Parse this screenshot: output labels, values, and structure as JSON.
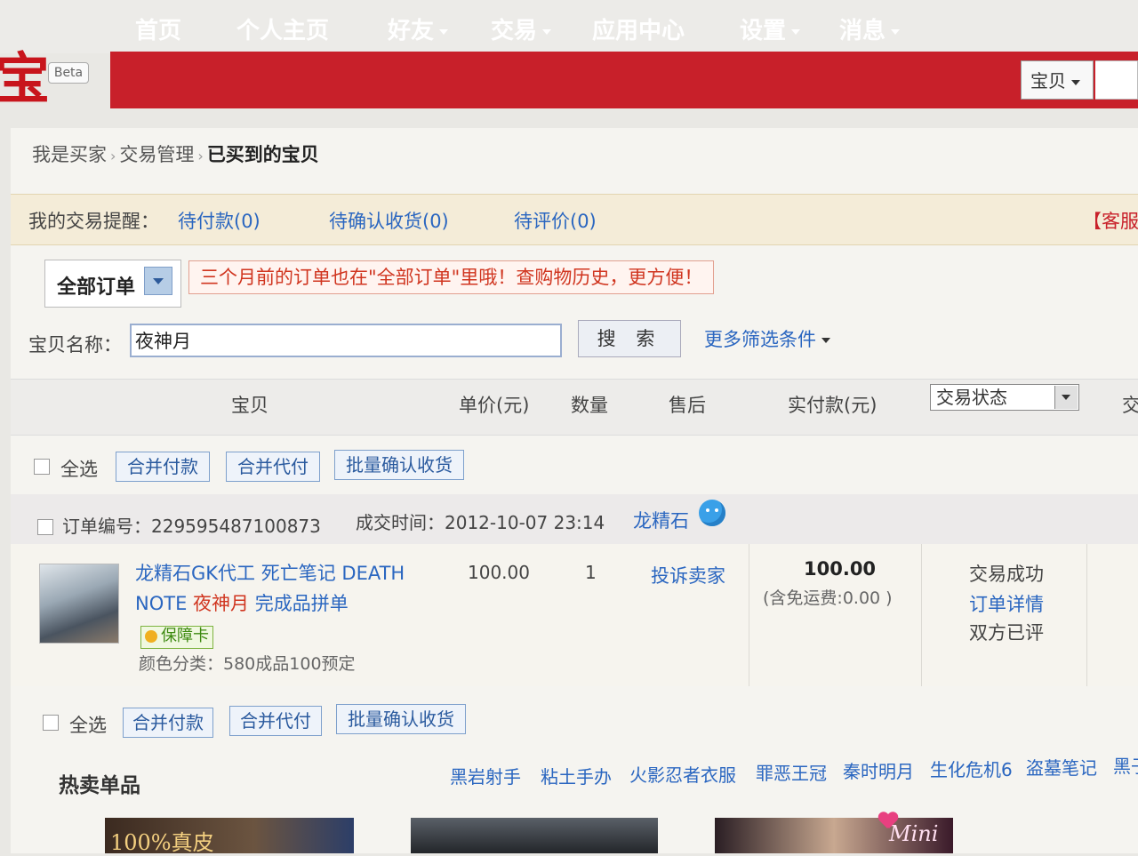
{
  "header": {
    "logo_char": "宝",
    "beta_label": "Beta",
    "nav": [
      "首页",
      "个人主页",
      "好友",
      "交易",
      "应用中心",
      "设置",
      "消息"
    ],
    "search_scope": "宝贝"
  },
  "breadcrumb": [
    "我是买家",
    "交易管理",
    "已买到的宝贝"
  ],
  "reminder": {
    "label": "我的交易提醒：",
    "links": [
      "待付款(0)",
      "待确认收货(0)",
      "待评价(0)"
    ],
    "right_link": "【客服"
  },
  "tabs": {
    "selected": "全部订单",
    "notice": "三个月前的订单也在\"全部订单\"里哦！查购物历史，更方便！"
  },
  "search": {
    "label": "宝贝名称：",
    "value": "夜神月",
    "button": "搜 索",
    "more_filters": "更多筛选条件"
  },
  "table": {
    "headers": [
      "宝贝",
      "单价(元)",
      "数量",
      "售后",
      "实付款(元)"
    ],
    "status_select": "交易状态",
    "extra_header": "交"
  },
  "bulk": {
    "select_all": "全选",
    "merge_pay": "合并付款",
    "merge_proxy": "合并代付",
    "batch_confirm": "批量确认收货"
  },
  "order": {
    "number_label": "订单编号：",
    "number": "229595487100873",
    "time_label": "成交时间：",
    "time": "2012-10-07 23:14",
    "seller": "龙精石",
    "item": {
      "title_part1": "龙精石GK代工 死亡笔记 DEATH NOTE ",
      "title_highlight": "夜神月",
      "title_part2": " 完成品拼单",
      "guarantee": "保障卡",
      "variant": "颜色分类：580成品100预定"
    },
    "price": "100.00",
    "qty": "1",
    "after_sale": "投诉卖家",
    "paid": "100.00",
    "shipping": "(含免运费:0.00 )",
    "status": "交易成功",
    "detail_link": "订单详情",
    "review": "双方已评"
  },
  "hot": {
    "title": "热卖单品",
    "links": [
      "黑岩射手",
      "粘土手办",
      "火影忍者衣服",
      "罪恶王冠",
      "秦时明月",
      "生化危机6",
      "盗墓笔记",
      "黑子"
    ],
    "banner1_text": "100%真皮",
    "banner3_text": "Mini"
  }
}
